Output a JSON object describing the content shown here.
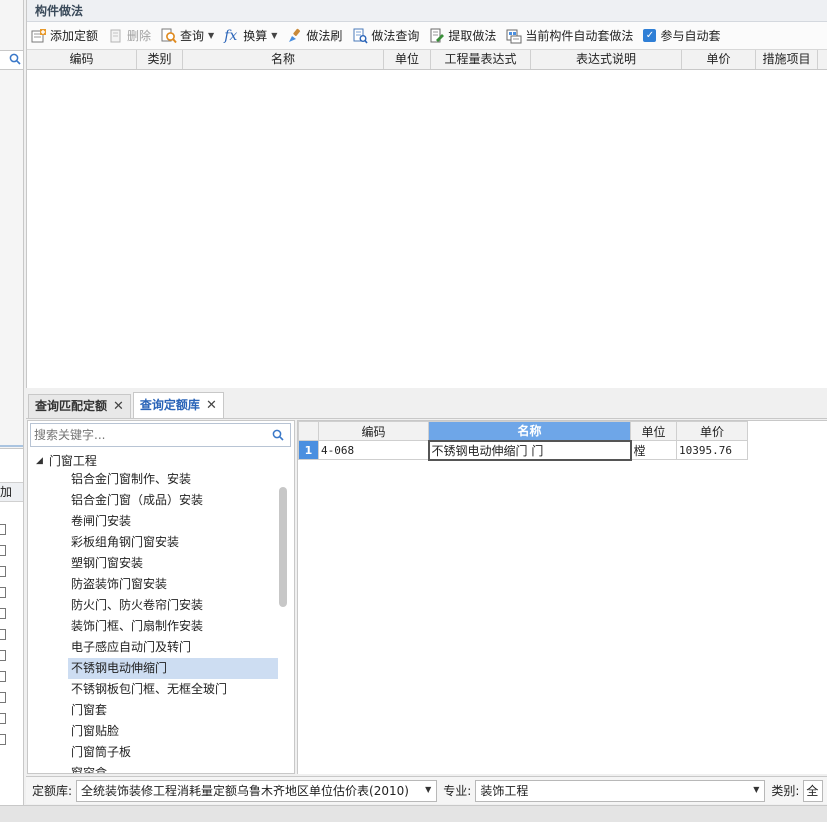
{
  "panel": {
    "title": "构件做法"
  },
  "toolbar": {
    "add_quota": "添加定额",
    "delete": "删除",
    "query": "查询",
    "convert": "换算",
    "method_brush": "做法刷",
    "method_query": "做法查询",
    "extract_method": "提取做法",
    "auto_apply_current": "当前构件自动套做法",
    "participate_auto": "参与自动套"
  },
  "main_grid": {
    "columns": [
      "编码",
      "类别",
      "名称",
      "单位",
      "工程量表达式",
      "表达式说明",
      "单价",
      "措施项目"
    ]
  },
  "tabs": [
    {
      "label": "查询匹配定额",
      "active": false
    },
    {
      "label": "查询定额库",
      "active": true
    }
  ],
  "tree": {
    "search_placeholder": "搜索关键字...",
    "root": "门窗工程",
    "items": [
      "铝合金门窗制作、安装",
      "铝合金门窗（成品）安装",
      "卷闸门安装",
      "彩板组角钢门窗安装",
      "塑钢门窗安装",
      "防盗装饰门窗安装",
      "防火门、防火卷帘门安装",
      "装饰门框、门扇制作安装",
      "电子感应自动门及转门",
      "不锈钢电动伸缩门",
      "不锈钢板包门框、无框全玻门",
      "门窗套",
      "门窗贴脸",
      "门窗筒子板",
      "窗帘盒"
    ],
    "selected_index": 9
  },
  "result_table": {
    "columns": [
      "编码",
      "名称",
      "单位",
      "单价"
    ],
    "rows": [
      {
        "no": "1",
        "code": "4-068",
        "name": "不锈钢电动伸缩门 门",
        "unit": "樘",
        "price": "10395.76"
      }
    ]
  },
  "bottom_bar": {
    "quota_lib_label": "定额库:",
    "quota_lib_value": "全统装饰装修工程消耗量定额乌鲁木齐地区单位估价表(2010)",
    "major_label": "专业:",
    "major_value": "装饰工程",
    "category_label": "类别:",
    "category_value": "全"
  },
  "left_strip": {
    "header_fragment": "加"
  },
  "colors": {
    "accent": "#2a64b8",
    "selection": "#cdddf2",
    "header_selected": "#6ea6e8"
  }
}
